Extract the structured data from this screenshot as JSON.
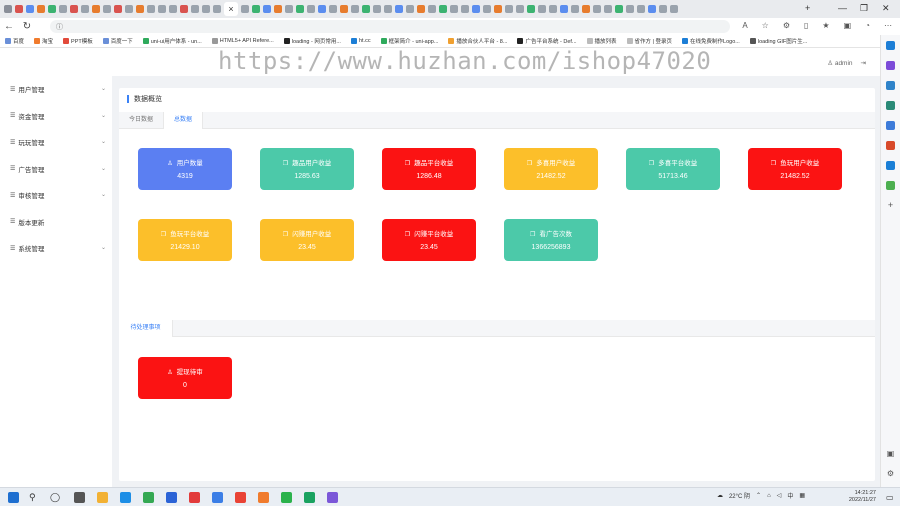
{
  "browser": {
    "active_tab_close": "×",
    "new_tab": "+",
    "window_controls": [
      "—",
      "❐",
      "✕"
    ],
    "bookmarks": [
      "百度",
      "淘宝",
      "PPT模板",
      "百度一下",
      "uni-ui用户体系 - un...",
      "HTML5+ API Refere...",
      "loading - 网页常用...",
      "ht.cc",
      "框架简介 - uni-app...",
      "播放合伙人平台 - 8...",
      "广告平台系统 - Def...",
      "播放列表",
      "省作方 | 登录页",
      "在线免费制作Logo...",
      "loading GIF图片生..."
    ]
  },
  "header": {
    "username": "admin",
    "logout_icon": "exit-icon"
  },
  "sidebar": {
    "items": [
      {
        "label": "用户管理"
      },
      {
        "label": "资金管理"
      },
      {
        "label": "玩玩管理"
      },
      {
        "label": "广告管理"
      },
      {
        "label": "审核管理"
      },
      {
        "label": "版本更新"
      },
      {
        "label": "系统管理"
      }
    ]
  },
  "panel": {
    "title": "数据概览",
    "tabs": [
      {
        "label": "今日数据",
        "active": false
      },
      {
        "label": "总数据",
        "active": true
      }
    ],
    "cards": [
      {
        "label": "用户数量",
        "value": "4319",
        "color": "#5b7ff2",
        "icon": "user-icon"
      },
      {
        "label": "趣品用户收益",
        "value": "1285.63",
        "color": "#4cc9a9",
        "icon": "book-icon"
      },
      {
        "label": "趣品平台收益",
        "value": "1286.48",
        "color": "#fb1313",
        "icon": "book-icon"
      },
      {
        "label": "多喜用户收益",
        "value": "21482.52",
        "color": "#fcbf2a",
        "icon": "book-icon"
      },
      {
        "label": "多喜平台收益",
        "value": "51713.46",
        "color": "#4cc9a9",
        "icon": "book-icon"
      },
      {
        "label": "鱼玩用户收益",
        "value": "21482.52",
        "color": "#fb1313",
        "icon": "book-icon"
      },
      {
        "label": "鱼玩平台收益",
        "value": "21429.10",
        "color": "#fcbf2a",
        "icon": "book-icon"
      },
      {
        "label": "闪赚用户收益",
        "value": "23.45",
        "color": "#fcbf2a",
        "icon": "book-icon"
      },
      {
        "label": "闪赚平台收益",
        "value": "23.45",
        "color": "#fb1313",
        "icon": "book-icon"
      },
      {
        "label": "看广告次数",
        "value": "1366256893",
        "color": "#4cc9a9",
        "icon": "book-icon"
      }
    ],
    "pending_tab": "待处理事项",
    "pending_cards": [
      {
        "label": "提现待审",
        "value": "0",
        "color": "#fb1313",
        "icon": "user-icon"
      }
    ]
  },
  "watermark": "https://www.huzhan.com/ishop47020",
  "taskbar": {
    "weather": "22°C 阴",
    "input_method": "中",
    "time": "14:21:27",
    "date": "2022/11/27"
  }
}
